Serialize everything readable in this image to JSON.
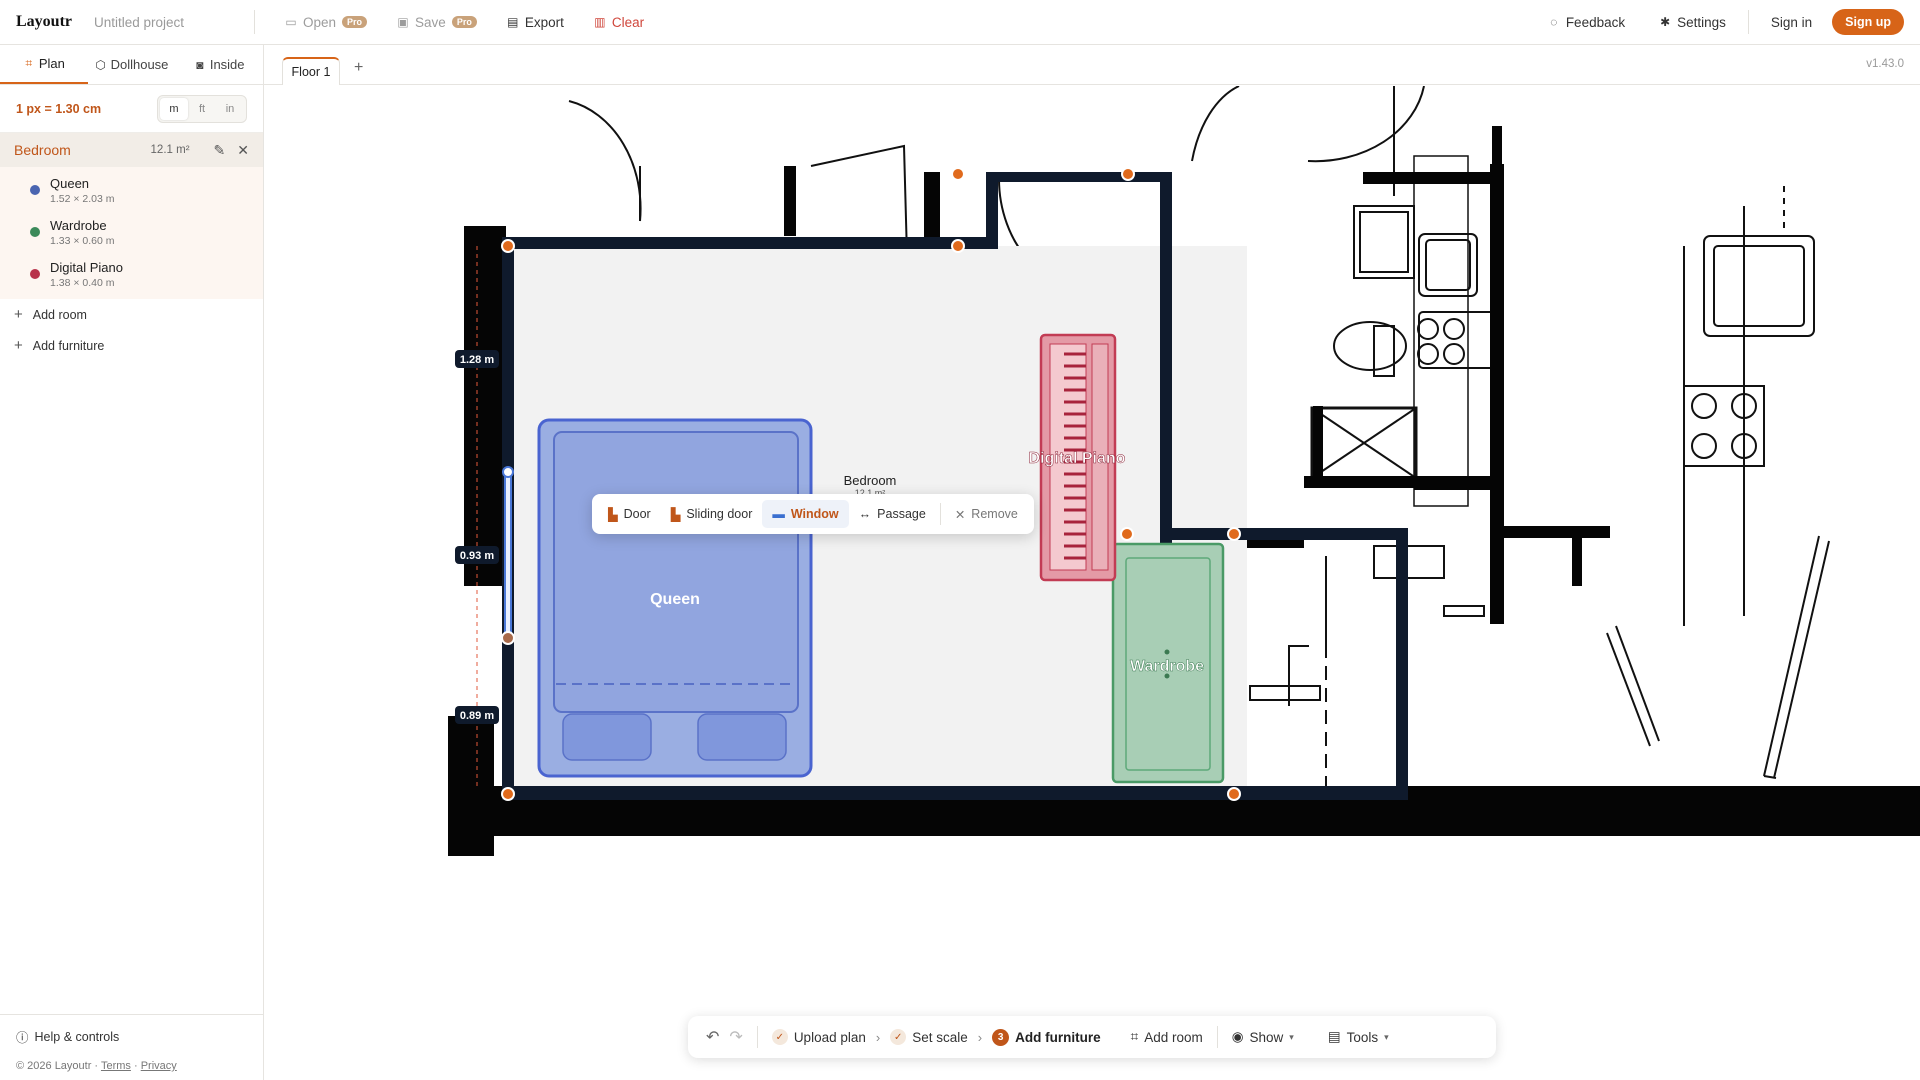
{
  "app": {
    "name": "Layoutr",
    "project": "Untitled project",
    "version": "v1.43.0"
  },
  "toolbar": {
    "open": "Open",
    "save": "Save",
    "pro_badge": "Pro",
    "export": "Export",
    "clear": "Clear",
    "feedback": "Feedback",
    "settings": "Settings",
    "signin": "Sign in",
    "signup": "Sign up"
  },
  "mode_tabs": [
    {
      "label": "Plan"
    },
    {
      "label": "Dollhouse"
    },
    {
      "label": "Inside"
    }
  ],
  "scale": {
    "text": "1 px = 1.30 cm",
    "units": [
      "m",
      "ft",
      "in"
    ],
    "active_unit": "m"
  },
  "room": {
    "name": "Bedroom",
    "area": "12.1 m²"
  },
  "furniture": [
    {
      "name": "Queen",
      "size": "1.52 × 2.03 m",
      "color": "#4a64b0"
    },
    {
      "name": "Wardrobe",
      "size": "1.33 × 0.60 m",
      "color": "#3c8a5a"
    },
    {
      "name": "Digital Piano",
      "size": "1.38 × 0.40 m",
      "color": "#b8324a"
    }
  ],
  "sidebar_actions": {
    "add_room": "Add room",
    "add_furniture": "Add furniture"
  },
  "footer": {
    "help": "Help & controls",
    "copyright": "© 2026 Layoutr ·",
    "terms": "Terms",
    "dot": "·",
    "privacy": "Privacy"
  },
  "floors": [
    {
      "label": "Floor 1"
    }
  ],
  "plan_labels": {
    "room_name": "Bedroom",
    "room_area": "12.1 m²",
    "queen": "Queen",
    "wardrobe": "Wardrobe",
    "piano": "Digital Piano",
    "dim1": "1.28 m",
    "dim2": "0.93 m",
    "dim3": "0.89 m"
  },
  "opening_popup": {
    "door": "Door",
    "sliding_door": "Sliding door",
    "window": "Window",
    "passage": "Passage",
    "remove": "Remove",
    "active": "Window"
  },
  "bottom_bar": {
    "upload_plan": "Upload plan",
    "set_scale": "Set scale",
    "step_number": "3",
    "add_furniture": "Add furniture",
    "add_room": "Add room",
    "show": "Show",
    "tools": "Tools"
  },
  "colors": {
    "accent": "#d76418",
    "accent_text": "#c0561a",
    "wall": "#0f1a2c",
    "bed": "#6f8bd6",
    "wardrobe": "#7fb595",
    "piano": "#d85c70"
  }
}
